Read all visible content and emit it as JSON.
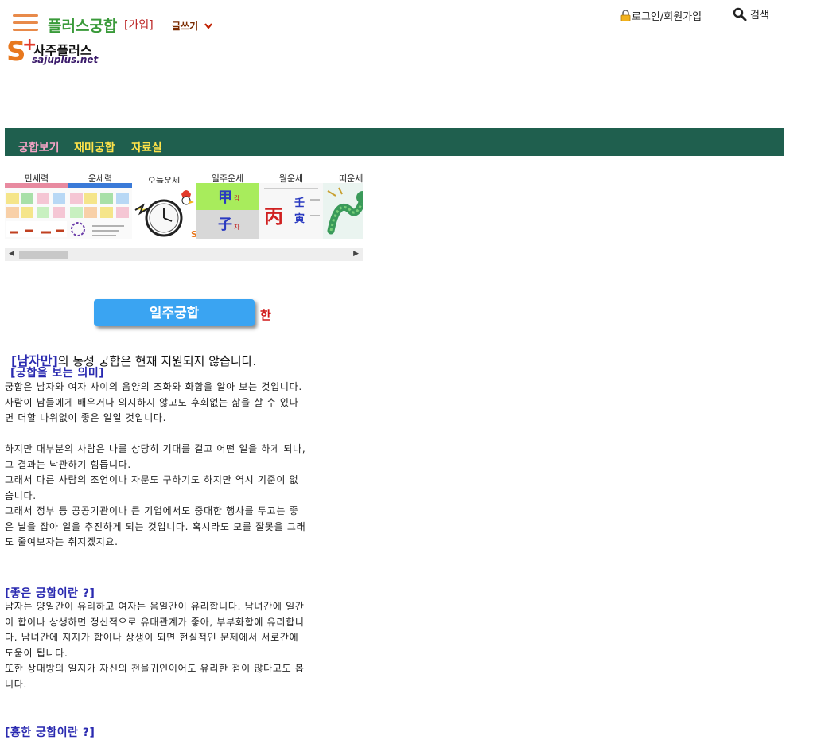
{
  "header": {
    "site_title": "플러스궁합",
    "join_label": "[가입]",
    "write_label": "글쓰기",
    "login_label": "로그인/회원가입",
    "search_label": "검색"
  },
  "logo": {
    "letter": "S",
    "plus": "+",
    "name": "사주플러스",
    "url": "sajuplus.net"
  },
  "nav": {
    "items": [
      {
        "label": "궁합보기",
        "color": "#f6a3c6"
      },
      {
        "label": "재미궁합",
        "color": "#ffe34a"
      },
      {
        "label": "자료실",
        "color": "#ffe34a"
      }
    ]
  },
  "carousel": {
    "cards": [
      {
        "label": "만세력"
      },
      {
        "label": "운세력"
      },
      {
        "label": "오늘운세"
      },
      {
        "label": "일주운세",
        "chars": [
          "甲",
          "갑",
          "子",
          "자"
        ]
      },
      {
        "label": "월운세",
        "chars": [
          "丙",
          "壬",
          "寅"
        ]
      },
      {
        "label": "띠운세"
      }
    ]
  },
  "main": {
    "button_label": "일주궁합",
    "han_mark": "한",
    "notice_mark": "[남자만]",
    "notice_text": "의 동성 궁합은 현재 지원되지 않습니다.",
    "sections": [
      {
        "title": "[궁합을 보는 의미]",
        "lines": [
          "궁합은 남자와 여자 사이의 음양의 조화와 화합을 알아 보는 것입니다.",
          "사람이 남들에게 배우거나 의지하지 않고도 후회없는 삶을 살 수 있다",
          "면 더할 나위없이 좋은 일일 것입니다.",
          "",
          "하지만 대부분의 사람은 나를 상당히 기대를 걸고 어떤 일을 하게 되나,",
          "그 결과는 낙관하기 힘듭니다.",
          "그래서 다른 사람의 조언이나 자문도 구하기도 하지만 역시 기준이 없",
          "습니다.",
          "그래서 정부 등 공공기관이나 큰 기업에서도 중대한 행사를 두고는 좋",
          "은 날을 잡아 일을 추진하게 되는 것입니다. 혹시라도 모를 잘못을 그래",
          "도 줄여보자는 취지겠지요."
        ]
      },
      {
        "title": "[좋은 궁합이란 ?]",
        "lines": [
          "남자는 양일간이 유리하고 여자는 음일간이 유리합니다. 남녀간에 일간",
          "이 합이나 상생하면 정신적으로 유대관계가 좋아, 부부화합에 유리합니",
          "다. 남녀간에 지지가 합이나 상생이 되면 현실적인 문제에서 서로간에",
          "도움이 됩니다.",
          "또한 상대방의 일지가 자신의 천을귀인이어도 유리한 점이 많다고도 봅",
          "니다."
        ]
      },
      {
        "title": "[흉한 궁합이란 ?]",
        "lines": []
      }
    ]
  }
}
